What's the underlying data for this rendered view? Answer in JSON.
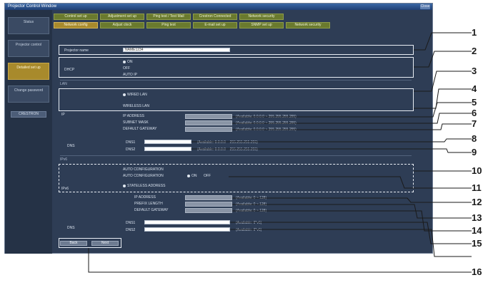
{
  "window": {
    "title": "Projector Control Window",
    "close_label": "Close"
  },
  "sidebar": {
    "items": [
      {
        "label": "Status"
      },
      {
        "label": "Projector control"
      },
      {
        "label": "Detailed set up"
      },
      {
        "label": "Change password"
      }
    ],
    "small_button": "CRESTRON"
  },
  "tabs": {
    "row1": [
      "Control set up",
      "Adjustment set up",
      "Ping test / Test Mail",
      "Crestron Connected",
      "Network security"
    ],
    "row2": [
      "Network config",
      "Adjust clock",
      "Ping test",
      "E-mail set up",
      "SNMP set up",
      "Network security"
    ]
  },
  "form": {
    "projector_name_label": "Projector name",
    "projector_name_value": "NAME1234",
    "dhcp_label": "DHCP",
    "dhcp_options": [
      "ON",
      "OFF",
      "AUTO IP"
    ],
    "lan_section": "LAN",
    "lan_options": [
      "WIRED LAN",
      "WIRELESS LAN"
    ],
    "ip_label": "IP",
    "ip_fields": [
      "IP ADDRESS",
      "SUBNET MASK",
      "DEFAULT GATEWAY"
    ],
    "ip_range": "(Available: 0.0.0.0 ~ 255.255.255.255)",
    "dns_label": "DNS",
    "dns_fields": [
      "DNS1",
      "DNS2"
    ],
    "dns_range": "(Available: 0.0.0.0 ~ 255.255.255.255)",
    "ipv6_section": "IPv6",
    "ipv6_opt1": "AUTO CONFIGURATION",
    "ipv6_opt2": "AUTO CONFIGURATION",
    "ipv6_onoff": [
      "ON",
      "OFF"
    ],
    "ipv6_sub": "STATELESS ADDRESS",
    "ipv6_label": "IPv6",
    "ipv6_fields": [
      "IP ADDRESS",
      "PREFIX LENGTH",
      "DEFAULT GATEWAY"
    ],
    "ipv6_range": "(Available: 0 ~ 128)",
    "dns6_label": "DNS",
    "dns6_fields": [
      "DNS1",
      "DNS2"
    ],
    "dns6_range": "(Available: IPv6)",
    "back_button": "Back",
    "next_button": "Next"
  },
  "callouts": [
    "1",
    "2",
    "3",
    "4",
    "5",
    "6",
    "7",
    "8",
    "9",
    "10",
    "11",
    "12",
    "13",
    "14",
    "15",
    "16"
  ]
}
